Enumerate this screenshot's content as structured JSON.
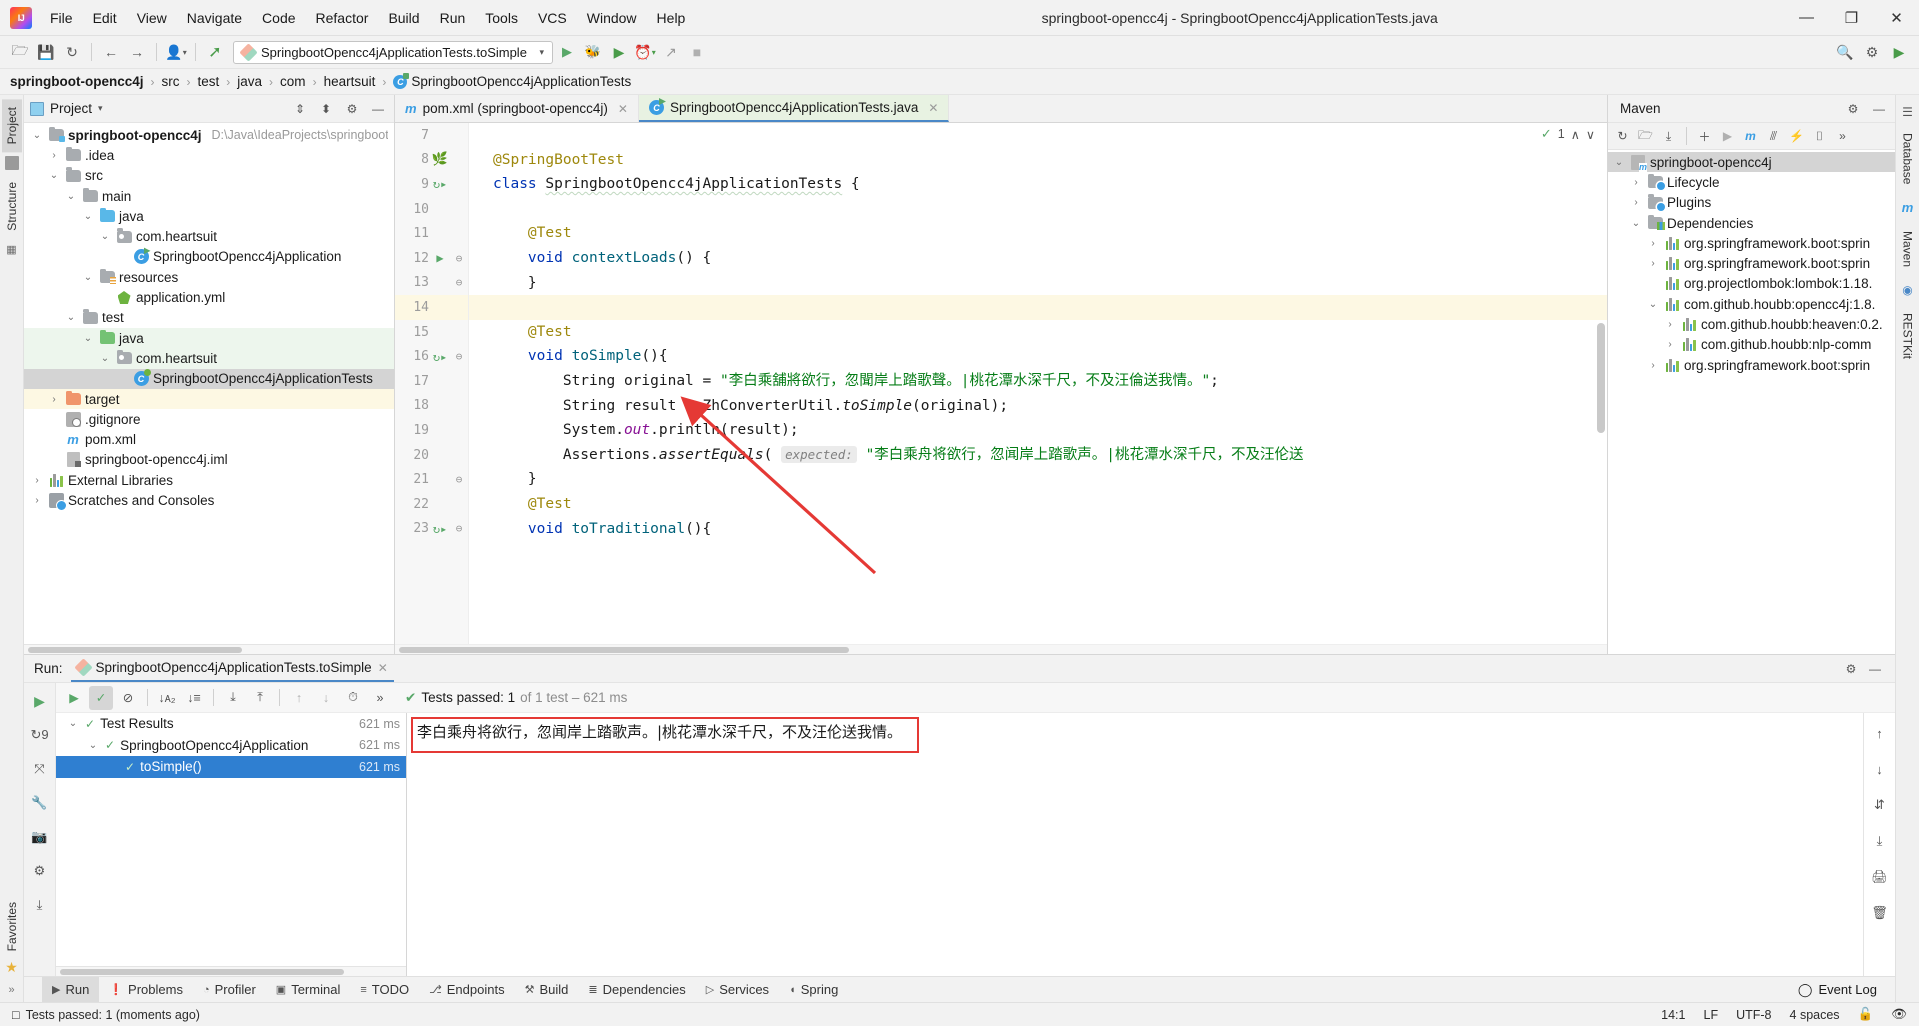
{
  "window": {
    "title": "springboot-opencc4j - SpringbootOpencc4jApplicationTests.java",
    "minimize": "—",
    "maximize": "❐",
    "close": "✕"
  },
  "menubar": [
    {
      "label": "File"
    },
    {
      "label": "Edit"
    },
    {
      "label": "View"
    },
    {
      "label": "Navigate"
    },
    {
      "label": "Code"
    },
    {
      "label": "Refactor"
    },
    {
      "label": "Build"
    },
    {
      "label": "Run"
    },
    {
      "label": "Tools"
    },
    {
      "label": "VCS"
    },
    {
      "label": "Window"
    },
    {
      "label": "Help"
    }
  ],
  "toolbar": {
    "open_icon": "🗁",
    "save_icon": "💾",
    "sync_icon": "↻",
    "back_icon": "←",
    "forward_icon": "→",
    "profile_icon": "👤",
    "build_icon": "⚒",
    "run_config": "SpringbootOpencc4jApplicationTests.toSimple",
    "run_icon": "▶",
    "debug_icon": "🐞",
    "coverage_icon": "▶",
    "profiler_icon": "⏱",
    "attach_icon": "↗",
    "stop_icon": "■",
    "search_icon": "🔍",
    "settings_icon": "⚙",
    "updates_icon": "▶"
  },
  "breadcrumb": {
    "items": [
      "springboot-opencc4j",
      "src",
      "test",
      "java",
      "com",
      "heartsuit",
      "SpringbootOpencc4jApplicationTests"
    ],
    "separator": "›"
  },
  "left_rail": [
    {
      "label": "Project",
      "active": true
    },
    {
      "label": "Structure",
      "active": false
    },
    {
      "label": "Favorites",
      "active": false
    }
  ],
  "right_rail": [
    {
      "label": "Database"
    },
    {
      "label": "Maven"
    },
    {
      "label": "RESTKit"
    }
  ],
  "project_panel": {
    "title": "Project",
    "caret": "▾",
    "collapse_all_icon": "⇕",
    "expand_icon": "⬍",
    "settings_icon": "⚙",
    "hide_icon": "—",
    "tree": [
      {
        "indent": 0,
        "arrow": "⌄",
        "icon": "module",
        "label": "springboot-opencc4j",
        "bold": true,
        "path": "D:\\Java\\IdeaProjects\\springboot",
        "row": "plain"
      },
      {
        "indent": 1,
        "arrow": "›",
        "icon": "folder",
        "label": ".idea",
        "row": "plain"
      },
      {
        "indent": 1,
        "arrow": "⌄",
        "icon": "folder",
        "label": "src",
        "row": "plain"
      },
      {
        "indent": 2,
        "arrow": "⌄",
        "icon": "folder",
        "label": "main",
        "row": "plain"
      },
      {
        "indent": 3,
        "arrow": "⌄",
        "icon": "folder-blue",
        "label": "java",
        "row": "plain"
      },
      {
        "indent": 4,
        "arrow": "⌄",
        "icon": "package",
        "label": "com.heartsuit",
        "row": "plain"
      },
      {
        "indent": 5,
        "arrow": "",
        "icon": "spring-class-run",
        "label": "SpringbootOpencc4jApplication",
        "row": "plain"
      },
      {
        "indent": 3,
        "arrow": "⌄",
        "icon": "folder-res",
        "label": "resources",
        "row": "plain"
      },
      {
        "indent": 4,
        "arrow": "",
        "icon": "yml",
        "label": "application.yml",
        "row": "plain"
      },
      {
        "indent": 2,
        "arrow": "⌄",
        "icon": "folder",
        "label": "test",
        "row": "plain"
      },
      {
        "indent": 3,
        "arrow": "⌄",
        "icon": "folder-green",
        "label": "java",
        "row": "green"
      },
      {
        "indent": 4,
        "arrow": "⌄",
        "icon": "package",
        "label": "com.heartsuit",
        "row": "green"
      },
      {
        "indent": 5,
        "arrow": "",
        "icon": "spring-class",
        "label": "SpringbootOpencc4jApplicationTests",
        "row": "selected"
      },
      {
        "indent": 1,
        "arrow": "›",
        "icon": "folder-orange",
        "label": "target",
        "row": "yellow"
      },
      {
        "indent": 1,
        "arrow": "",
        "icon": "git",
        "label": ".gitignore",
        "row": "plain"
      },
      {
        "indent": 1,
        "arrow": "",
        "icon": "maven-m",
        "label": "pom.xml",
        "row": "plain"
      },
      {
        "indent": 1,
        "arrow": "",
        "icon": "iml",
        "label": "springboot-opencc4j.iml",
        "row": "plain"
      },
      {
        "indent": 0,
        "arrow": "›",
        "icon": "library",
        "label": "External Libraries",
        "row": "plain"
      },
      {
        "indent": 0,
        "arrow": "›",
        "icon": "scratch",
        "label": "Scratches and Consoles",
        "row": "plain"
      }
    ]
  },
  "editor": {
    "tabs": [
      {
        "label": "pom.xml (springboot-opencc4j)",
        "icon": "maven-m",
        "active": false,
        "close": "✕"
      },
      {
        "label": "SpringbootOpencc4jApplicationTests.java",
        "icon": "spring-class",
        "active": true,
        "close": "✕"
      }
    ],
    "inspection_count": "1",
    "inspection_up": "∧",
    "inspection_down": "∨",
    "lines": [
      {
        "num": "7",
        "mark": "",
        "fold": "",
        "cur": false,
        "html": ""
      },
      {
        "num": "8",
        "mark": "spring",
        "fold": "",
        "cur": false,
        "html": "<span class='ann'>@SpringBootTest</span>"
      },
      {
        "num": "9",
        "mark": "runtest",
        "fold": "",
        "cur": false,
        "html": "<span class='k'>class</span> <span class='wavy'>SpringbootOpencc4jApplicationTests</span> {"
      },
      {
        "num": "10",
        "mark": "",
        "fold": "",
        "cur": false,
        "html": ""
      },
      {
        "num": "11",
        "mark": "",
        "fold": "",
        "cur": false,
        "html": "&nbsp;&nbsp;&nbsp;&nbsp;<span class='ann'>@Test</span>"
      },
      {
        "num": "12",
        "mark": "play",
        "fold": "⊖",
        "cur": false,
        "html": "&nbsp;&nbsp;&nbsp;&nbsp;<span class='k'>void</span> <span class='fn'>contextLoads</span>() {"
      },
      {
        "num": "13",
        "mark": "",
        "fold": "⊖",
        "cur": false,
        "html": "&nbsp;&nbsp;&nbsp;&nbsp;}"
      },
      {
        "num": "14",
        "mark": "",
        "fold": "",
        "cur": true,
        "html": ""
      },
      {
        "num": "15",
        "mark": "",
        "fold": "",
        "cur": false,
        "html": "&nbsp;&nbsp;&nbsp;&nbsp;<span class='ann'>@Test</span>"
      },
      {
        "num": "16",
        "mark": "runtest",
        "fold": "⊖",
        "cur": false,
        "html": "&nbsp;&nbsp;&nbsp;&nbsp;<span class='k'>void</span> <span class='fn'>toSimple</span>(){"
      },
      {
        "num": "17",
        "mark": "",
        "fold": "",
        "cur": false,
        "html": "&nbsp;&nbsp;&nbsp;&nbsp;&nbsp;&nbsp;&nbsp;&nbsp;String original = <span class='str'>\"李白乘舖將欲行，忽聞岸上踏歌聲。|桃花潭水深千尺，不及汪倫送我情。\"</span>;"
      },
      {
        "num": "18",
        "mark": "",
        "fold": "",
        "cur": false,
        "html": "&nbsp;&nbsp;&nbsp;&nbsp;&nbsp;&nbsp;&nbsp;&nbsp;String result = ZhConverterUtil.<span class='it'>toSimple</span>(original);"
      },
      {
        "num": "19",
        "mark": "",
        "fold": "",
        "cur": false,
        "html": "&nbsp;&nbsp;&nbsp;&nbsp;&nbsp;&nbsp;&nbsp;&nbsp;System.<span class='purple'>out</span>.println(result);"
      },
      {
        "num": "20",
        "mark": "",
        "fold": "",
        "cur": false,
        "html": "&nbsp;&nbsp;&nbsp;&nbsp;&nbsp;&nbsp;&nbsp;&nbsp;Assertions.<span class='it'>assertEquals</span>( <span class='hint'>expected:</span> <span class='str'>\"李白乘舟将欲行，忽闻岸上踏歌声。|桃花潭水深千尺，不及汪伦送</span>"
      },
      {
        "num": "21",
        "mark": "",
        "fold": "⊖",
        "cur": false,
        "html": "&nbsp;&nbsp;&nbsp;&nbsp;}"
      },
      {
        "num": "22",
        "mark": "",
        "fold": "",
        "cur": false,
        "html": "&nbsp;&nbsp;&nbsp;&nbsp;<span class='ann'>@Test</span>"
      },
      {
        "num": "23",
        "mark": "runtest",
        "fold": "⊖",
        "cur": false,
        "html": "&nbsp;&nbsp;&nbsp;&nbsp;<span class='k'>void</span> <span class='fn'>toTraditional</span>(){"
      }
    ]
  },
  "maven": {
    "title": "Maven",
    "settings_icon": "⚙",
    "hide_icon": "—",
    "toolbar_icons": [
      "↻",
      "🗁",
      "⤓",
      "＋",
      "▶",
      "m",
      "⫻",
      "⚡",
      "⌷",
      "»"
    ],
    "tree": [
      {
        "indent": 0,
        "arrow": "⌄",
        "icon": "mvn-project",
        "label": "springboot-opencc4j",
        "selected": true
      },
      {
        "indent": 1,
        "arrow": "›",
        "icon": "gear-folder",
        "label": "Lifecycle"
      },
      {
        "indent": 1,
        "arrow": "›",
        "icon": "gear-folder",
        "label": "Plugins"
      },
      {
        "indent": 1,
        "arrow": "⌄",
        "icon": "deps-folder",
        "label": "Dependencies"
      },
      {
        "indent": 2,
        "arrow": "›",
        "icon": "lib",
        "label": "org.springframework.boot:sprin"
      },
      {
        "indent": 2,
        "arrow": "›",
        "icon": "lib",
        "label": "org.springframework.boot:sprin"
      },
      {
        "indent": 2,
        "arrow": "",
        "icon": "lib",
        "label": "org.projectlombok:lombok:1.18."
      },
      {
        "indent": 2,
        "arrow": "⌄",
        "icon": "lib",
        "label": "com.github.houbb:opencc4j:1.8."
      },
      {
        "indent": 3,
        "arrow": "›",
        "icon": "lib",
        "label": "com.github.houbb:heaven:0.2."
      },
      {
        "indent": 3,
        "arrow": "›",
        "icon": "lib",
        "label": "com.github.houbb:nlp-comm"
      },
      {
        "indent": 2,
        "arrow": "›",
        "icon": "lib",
        "label": "org.springframework.boot:sprin"
      }
    ]
  },
  "run_panel": {
    "label": "Run:",
    "tab_title": "SpringbootOpencc4jApplicationTests.toSimple",
    "tab_close": "✕",
    "settings_icon": "⚙",
    "hide_icon": "—",
    "side_icons": [
      "▶",
      "↻9",
      "⤧",
      "🔧",
      "📷",
      "⚙",
      "⤓"
    ],
    "toolbar": {
      "rerun_icon": "▶",
      "passed_filter_icon": "✓",
      "ignored_filter_icon": "⊘",
      "sort_alpha_icon": "↓ᴀ₂",
      "sort_duration_icon": "↓≡",
      "expand_all_icon": "⤓",
      "collapse_all_icon": "⤒",
      "prev_icon": "↑",
      "next_icon": "↓",
      "history_icon": "⏱",
      "more_icon": "»"
    },
    "status": {
      "check": "✔",
      "main": "Tests passed: 1",
      "detail": "of 1 test – 621 ms"
    },
    "tests": [
      {
        "indent": 0,
        "arrow": "⌄",
        "label": "Test Results",
        "time": "621 ms",
        "selected": false
      },
      {
        "indent": 1,
        "arrow": "⌄",
        "label": "SpringbootOpencc4jApplication",
        "time": "621 ms",
        "selected": false
      },
      {
        "indent": 2,
        "arrow": "",
        "label": "toSimple()",
        "time": "621 ms",
        "selected": true
      }
    ],
    "console_output": "李白乘舟将欲行，忽闻岸上踏歌声。|桃花潭水深千尺，不及汪伦送我情。",
    "console_rail_icons": [
      "↑",
      "↓",
      "⇵",
      "⤓",
      "🖨",
      "🗑"
    ],
    "highlight_color": "#e53935"
  },
  "bottom_tabs": [
    {
      "label": "Run",
      "icon": "▶",
      "active": true
    },
    {
      "label": "Problems",
      "icon": "❗",
      "active": false
    },
    {
      "label": "Profiler",
      "icon": "◔",
      "active": false
    },
    {
      "label": "Terminal",
      "icon": "▣",
      "active": false
    },
    {
      "label": "TODO",
      "icon": "≡",
      "active": false
    },
    {
      "label": "Endpoints",
      "icon": "⎇",
      "active": false
    },
    {
      "label": "Build",
      "icon": "⚒",
      "active": false
    },
    {
      "label": "Dependencies",
      "icon": "≣",
      "active": false
    },
    {
      "label": "Services",
      "icon": "▷",
      "active": false
    },
    {
      "label": "Spring",
      "icon": "◖",
      "active": false
    }
  ],
  "event_log": {
    "icon": "◯",
    "label": "Event Log"
  },
  "statusbar": {
    "message_icon": "□",
    "message": "Tests passed: 1 (moments ago)",
    "caret_position": "14:1",
    "line_separator": "LF",
    "encoding": "UTF-8",
    "indent": "4 spaces",
    "lock_icon": "🔓",
    "inspection_icon": "👁"
  }
}
